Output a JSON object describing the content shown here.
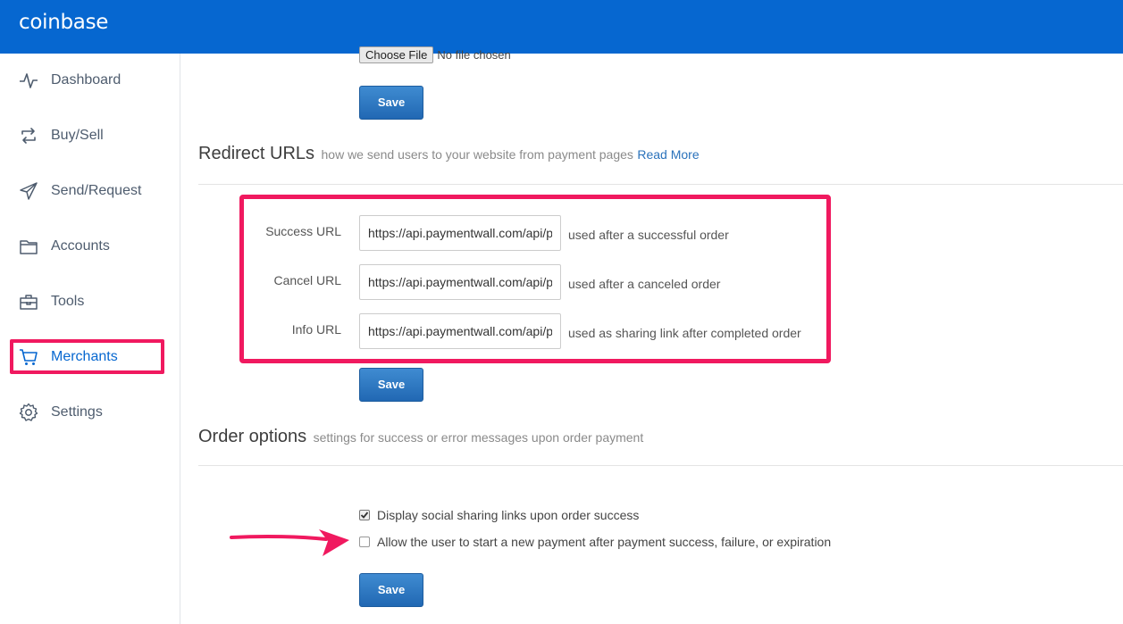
{
  "app": {
    "brand": "coinbase",
    "brand_color": "#0667d0",
    "highlight_color": "#f0195f"
  },
  "sidebar": {
    "items": [
      {
        "label": "Dashboard",
        "icon": "activity-icon"
      },
      {
        "label": "Buy/Sell",
        "icon": "refresh-icon"
      },
      {
        "label": "Send/Request",
        "icon": "send-icon"
      },
      {
        "label": "Accounts",
        "icon": "folder-icon"
      },
      {
        "label": "Tools",
        "icon": "toolbox-icon"
      },
      {
        "label": "Merchants",
        "icon": "cart-icon",
        "active": true
      },
      {
        "label": "Settings",
        "icon": "gear-icon"
      }
    ]
  },
  "upload": {
    "button_label": "Choose File",
    "status": "No file chosen"
  },
  "buttons": {
    "save": "Save"
  },
  "redirect": {
    "title": "Redirect URLs",
    "subtitle": "how we send users to your website from payment pages",
    "link": "Read More",
    "rows": [
      {
        "label": "Success URL",
        "value": "https://api.paymentwall.com/api/p",
        "hint": "used after a successful order"
      },
      {
        "label": "Cancel URL",
        "value": "https://api.paymentwall.com/api/p",
        "hint": "used after a canceled order"
      },
      {
        "label": "Info URL",
        "value": "https://api.paymentwall.com/api/p",
        "hint": "used as sharing link after completed order"
      }
    ]
  },
  "order": {
    "title": "Order options",
    "subtitle": "settings for success or error messages upon order payment",
    "options": [
      {
        "label": "Display social sharing links upon order success",
        "checked": true
      },
      {
        "label": "Allow the user to start a new payment after payment success, failure, or expiration",
        "checked": false
      }
    ]
  }
}
